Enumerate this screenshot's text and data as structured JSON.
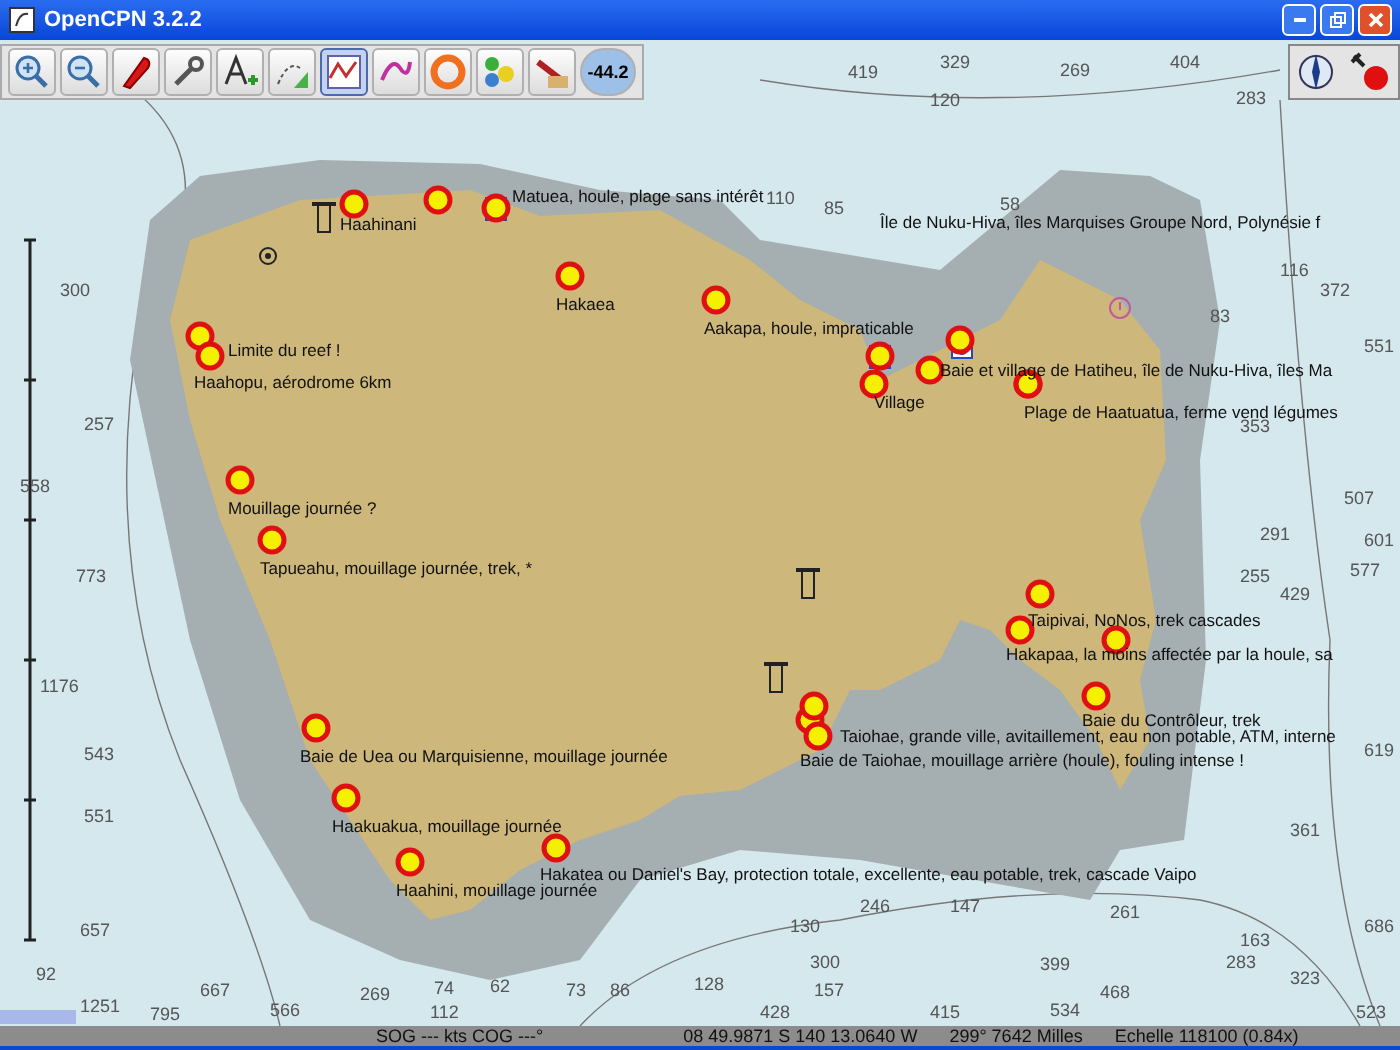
{
  "window": {
    "title": "OpenCPN 3.2.2"
  },
  "toolbar": {
    "tools": [
      {
        "selected": false
      },
      {
        "selected": false
      },
      {
        "selected": false
      },
      {
        "selected": false
      },
      {
        "selected": false
      },
      {
        "selected": false
      },
      {
        "selected": true
      },
      {
        "selected": false
      },
      {
        "selected": false
      },
      {
        "selected": false
      },
      {
        "selected": false
      }
    ],
    "readout": "-44.2"
  },
  "map": {
    "waypoints": [
      {
        "label": "Haahinani"
      },
      {
        "label": "Matuea, houle, plage sans intérêt"
      },
      {
        "label": "Île de Nuku-Hiva, îles Marquises Groupe Nord, Polynésie f"
      },
      {
        "label": "Hakaea"
      },
      {
        "label": "Aakapa, houle, impraticable"
      },
      {
        "label": "Limite du reef !"
      },
      {
        "label": "Haahopu, aérodrome 6km"
      },
      {
        "label": "Baie et village de Hatiheu, île de Nuku-Hiva, îles Ma"
      },
      {
        "label": "Village"
      },
      {
        "label": "Plage de Haatuatua, ferme vend légumes"
      },
      {
        "label": "Mouillage journée ?"
      },
      {
        "label": "Tapueahu, mouillage journée, trek, *"
      },
      {
        "label": "Taipivai, NoNos, trek cascades"
      },
      {
        "label": "Hakapaa, la moins affectée par la houle, sa"
      },
      {
        "label": "Baie du Contrôleur, trek"
      },
      {
        "label": "Taiohae, grande ville, avitaillement, eau non potable, ATM, interne"
      },
      {
        "label": "Baie de Uea ou Marquisienne, mouillage journée"
      },
      {
        "label": "Baie de Taiohae, mouillage arrière (houle), fouling intense !"
      },
      {
        "label": "Haakuakua, mouillage journée"
      },
      {
        "label": "Haahini, mouillage journée"
      },
      {
        "label": "Hakatea ou Daniel's Bay, protection totale, excellente, eau potable, trek, cascade Vaipo"
      }
    ],
    "soundings": [
      "419",
      "329",
      "269",
      "404",
      "120",
      "283",
      "110",
      "85",
      "58",
      "116",
      "300",
      "372",
      "83",
      "551",
      "257",
      "353",
      "558",
      "507",
      "291",
      "601",
      "773",
      "255",
      "577",
      "429",
      "1176",
      "543",
      "619",
      "551",
      "361",
      "246",
      "147",
      "261",
      "657",
      "130",
      "686",
      "163",
      "300",
      "399",
      "283",
      "92",
      "667",
      "269",
      "74",
      "62",
      "73",
      "86",
      "128",
      "157",
      "468",
      "323",
      "1251",
      "795",
      "566",
      "112",
      "428",
      "415",
      "534",
      "523"
    ]
  },
  "status_bar": {
    "speed": "SOG --- kts  COG ---°",
    "position": "08 49.9871 S   140 13.0640 W",
    "bearing": "299°  7642 Milles",
    "scale": "Echelle 118100 (0.84x)"
  }
}
